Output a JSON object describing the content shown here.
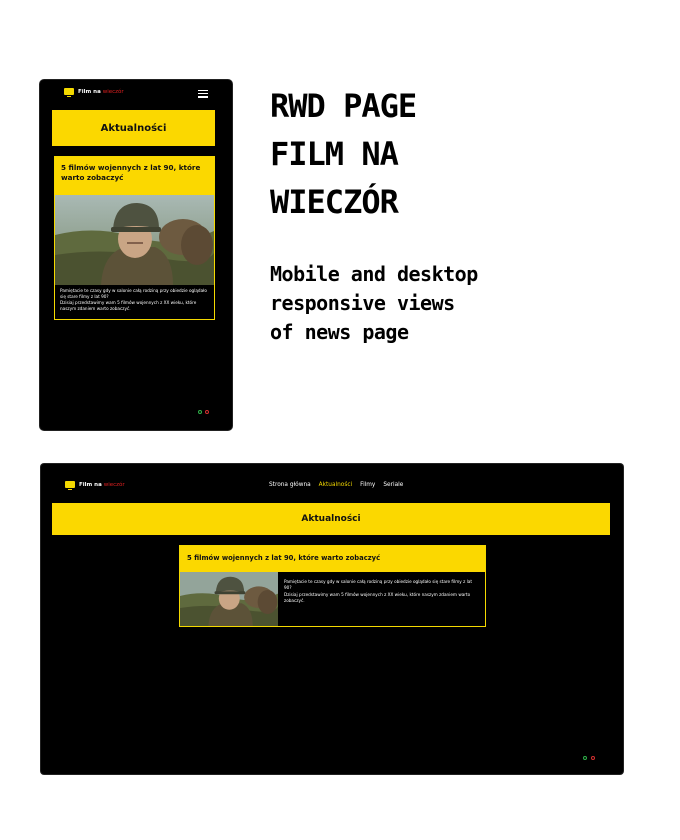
{
  "brand": {
    "name": "Film na",
    "accent": "wieczór",
    "accent_color": "#e02020",
    "yellow": "#fbd800"
  },
  "mobile": {
    "page_banner": "Aktualności",
    "menu_icon": "hamburger-icon",
    "article": {
      "title": "5 filmów wojennych z lat 90, które warto zobaczyć",
      "image_alt": "soldier-in-helmet",
      "desc_lines": [
        "Pamiętacie te czasy gdy w salonie całą rodziną przy obiedzie oglądało się stare filmy z lat 90?",
        "Dzisiaj przedstawimy wam 5 filmów wojennych z XX wieku, które naszym zdaniem warto zobaczyć."
      ]
    }
  },
  "desktop": {
    "nav": [
      {
        "label": "Strona główna",
        "active": false
      },
      {
        "label": "Aktualności",
        "active": true
      },
      {
        "label": "Filmy",
        "active": false
      },
      {
        "label": "Seriale",
        "active": false
      }
    ],
    "page_banner": "Aktualności",
    "article": {
      "title": "5 filmów wojennych z lat 90, które warto zobaczyć",
      "desc_lines": [
        "Pamiętacie te czasy gdy w salonie całą rodziną przy obiedzie oglądało się stare filmy z lat 90?",
        "Dzisiaj przedstawimy wam 5 filmów wojennych z XX wieku, które naszym zdaniem warto zobaczyć."
      ]
    }
  },
  "headline_lines": [
    "RWD PAGE",
    "FILM NA",
    "WIECZÓR"
  ],
  "subline_lines": [
    "Mobile and desktop",
    "responsive views",
    "of news page"
  ]
}
